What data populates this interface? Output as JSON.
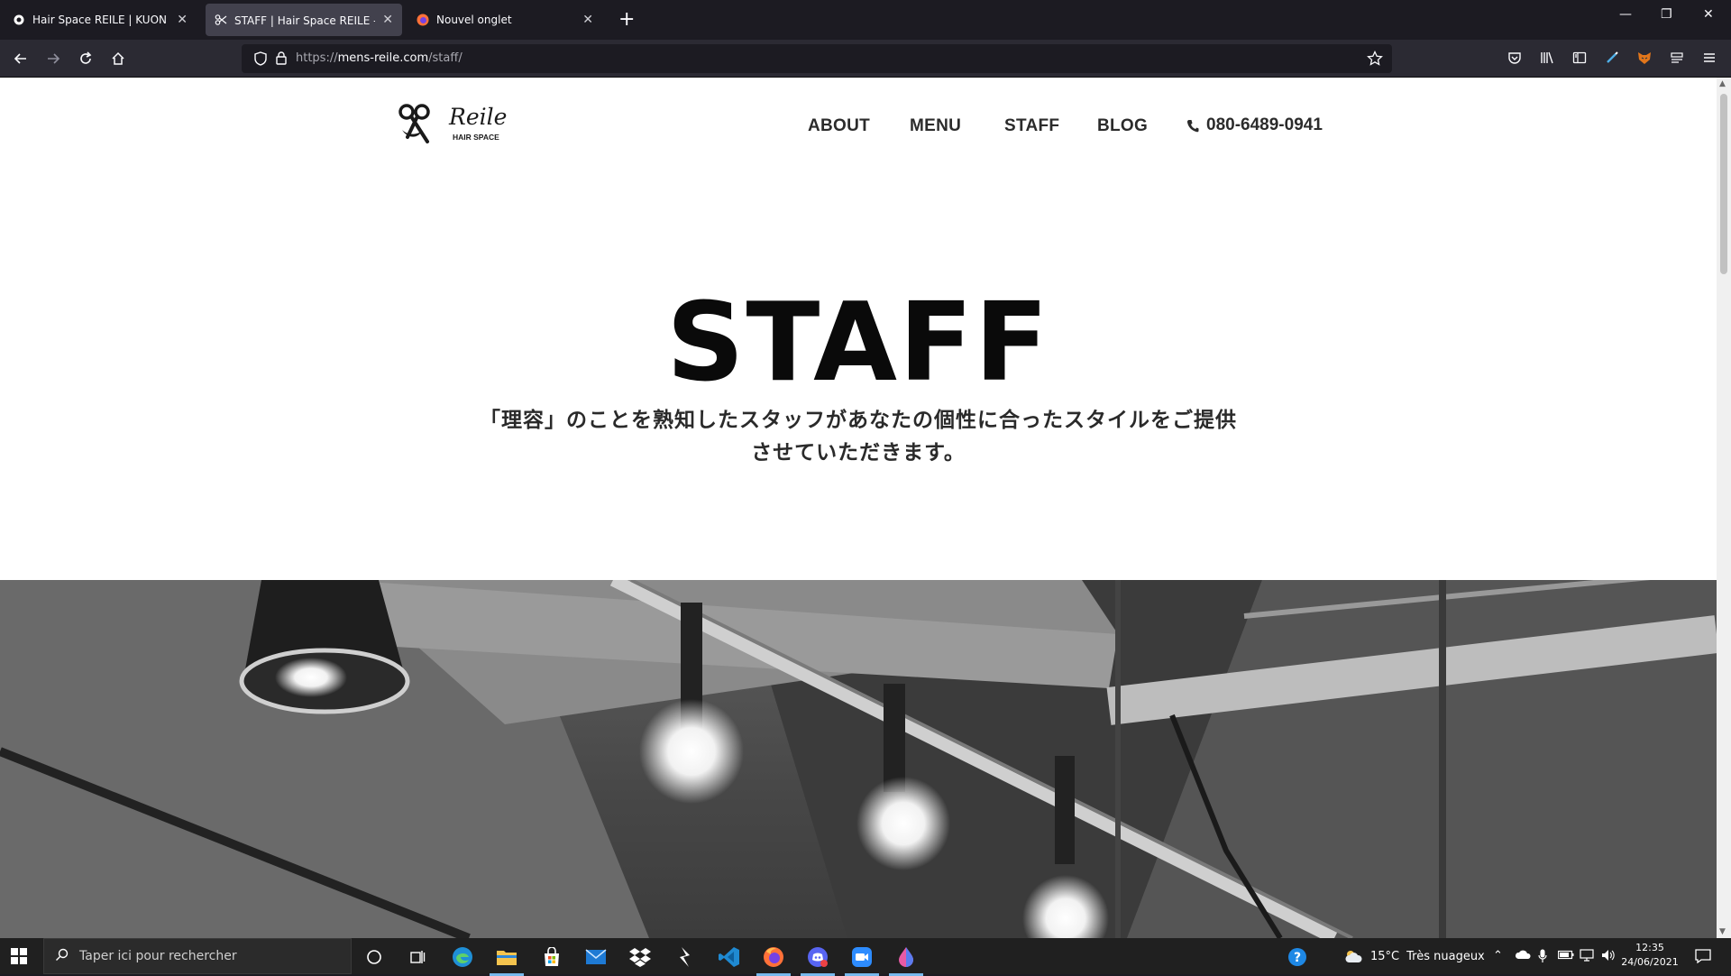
{
  "browser": {
    "tabs": [
      {
        "title": "Hair Space REILE | KUON YAGI P",
        "active": false
      },
      {
        "title": "STAFF | Hair Space REILE - ヘア",
        "active": true
      },
      {
        "title": "Nouvel onglet",
        "active": false
      }
    ],
    "url_prefix": "https://",
    "url_host": "mens-reile.com",
    "url_path": "/staff/"
  },
  "site": {
    "logo_text": "Reile",
    "logo_sub": "HAIR SPACE",
    "nav": [
      "ABOUT",
      "MENU",
      "STAFF",
      "BLOG"
    ],
    "phone": "080-6489-0941",
    "hero_title": "STAFF",
    "hero_sub_line1": "「理容」のことを熟知したスタッフがあなたの個性に合ったスタイルをご提供",
    "hero_sub_line2": "させていただきます。"
  },
  "taskbar": {
    "search_placeholder": "Taper ici pour rechercher",
    "weather_temp": "15°C",
    "weather_desc": "Très nuageux",
    "time": "12:35",
    "date": "24/06/2021"
  }
}
